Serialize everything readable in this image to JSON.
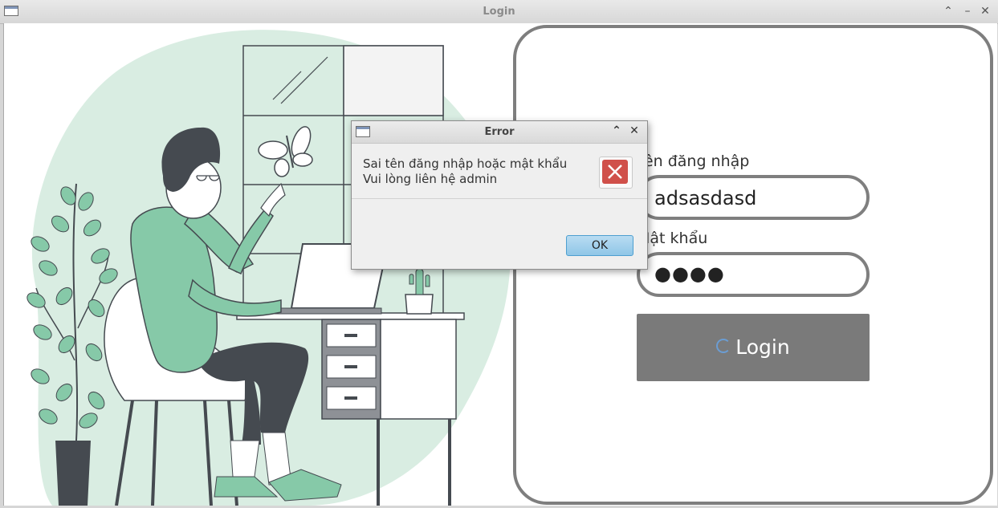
{
  "window": {
    "title": "Login",
    "controls": {
      "minimize": "⌃",
      "minimize2": "–",
      "close": "✕"
    }
  },
  "form": {
    "username_label": "Tên đăng nhập",
    "username_value": "adsasdasd",
    "password_label": "Mật khẩu",
    "password_mask": "●●●●",
    "login_label": "Login"
  },
  "dialog": {
    "title": "Error",
    "message_line1": "Sai tên đăng nhập hoặc mật khẩu",
    "message_line2": "Vui lòng liên hệ admin",
    "ok_label": "OK",
    "controls": {
      "collapse": "⌃",
      "close": "✕"
    }
  },
  "colors": {
    "accent_green": "#86c9a8",
    "bg_blob": "#d9ede2",
    "dark": "#454a50",
    "button_gray": "#7a7a7a",
    "error_red": "#d0504a"
  }
}
